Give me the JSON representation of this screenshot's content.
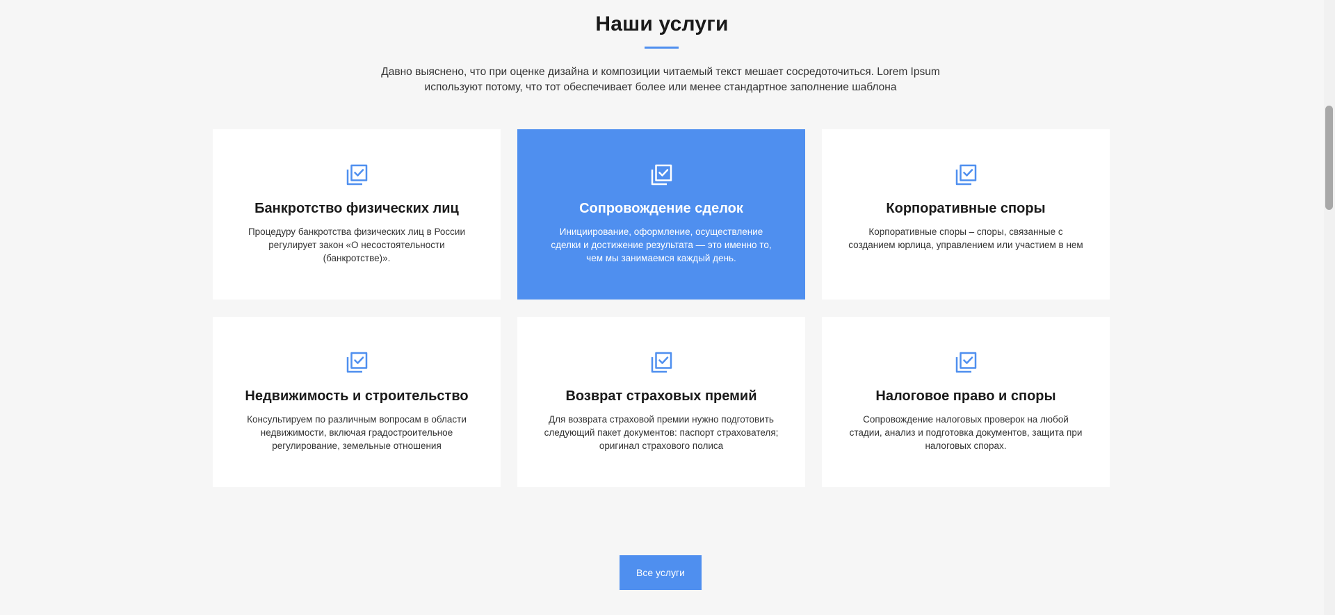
{
  "section": {
    "title": "Наши услуги",
    "intro_line1": "Давно выяснено, что при оценке дизайна и композиции читаемый текст мешает сосредоточиться. Lorem Ipsum",
    "intro_line2": "используют потому, что тот обеспечивает более или менее стандартное заполнение шаблона"
  },
  "cards": [
    {
      "title": "Банкротство физических лиц",
      "text": "Процедуру банкротства физических лиц в России регулирует закон «О несостоятельности (банкротстве)».",
      "icon": "checklist-icon",
      "active": false
    },
    {
      "title": "Сопровождение сделок",
      "text": "Инициирование, оформление, осуществление сделки и достижение результата — это именно то, чем мы занимаемся каждый день.",
      "icon": "checklist-icon",
      "active": true
    },
    {
      "title": "Корпоративные споры",
      "text": "Корпоративные споры – споры, связанные с созданием юрлица, управлением или участием в нем",
      "icon": "checklist-icon",
      "active": false
    },
    {
      "title": "Недвижимость и строительство",
      "text": "Консультируем по различным вопросам в области недвижимости, включая градостроительное регулирование, земельные отношения",
      "icon": "checklist-icon",
      "active": false
    },
    {
      "title": "Возврат страховых премий",
      "text": "Для возврата страховой премии нужно подготовить следующий пакет документов: паспорт страхователя; оригинал страхового полиса",
      "icon": "checklist-icon",
      "active": false
    },
    {
      "title": "Налоговое право и споры",
      "text": "Сопровождение налоговых проверок на любой стадии, анализ и подготовка документов, защита при налоговых спорах.",
      "icon": "checklist-icon",
      "active": false
    }
  ],
  "all_services_button": "Все услуги",
  "colors": {
    "accent": "#4f8fef",
    "background": "#f6f6f6",
    "card": "#ffffff"
  }
}
